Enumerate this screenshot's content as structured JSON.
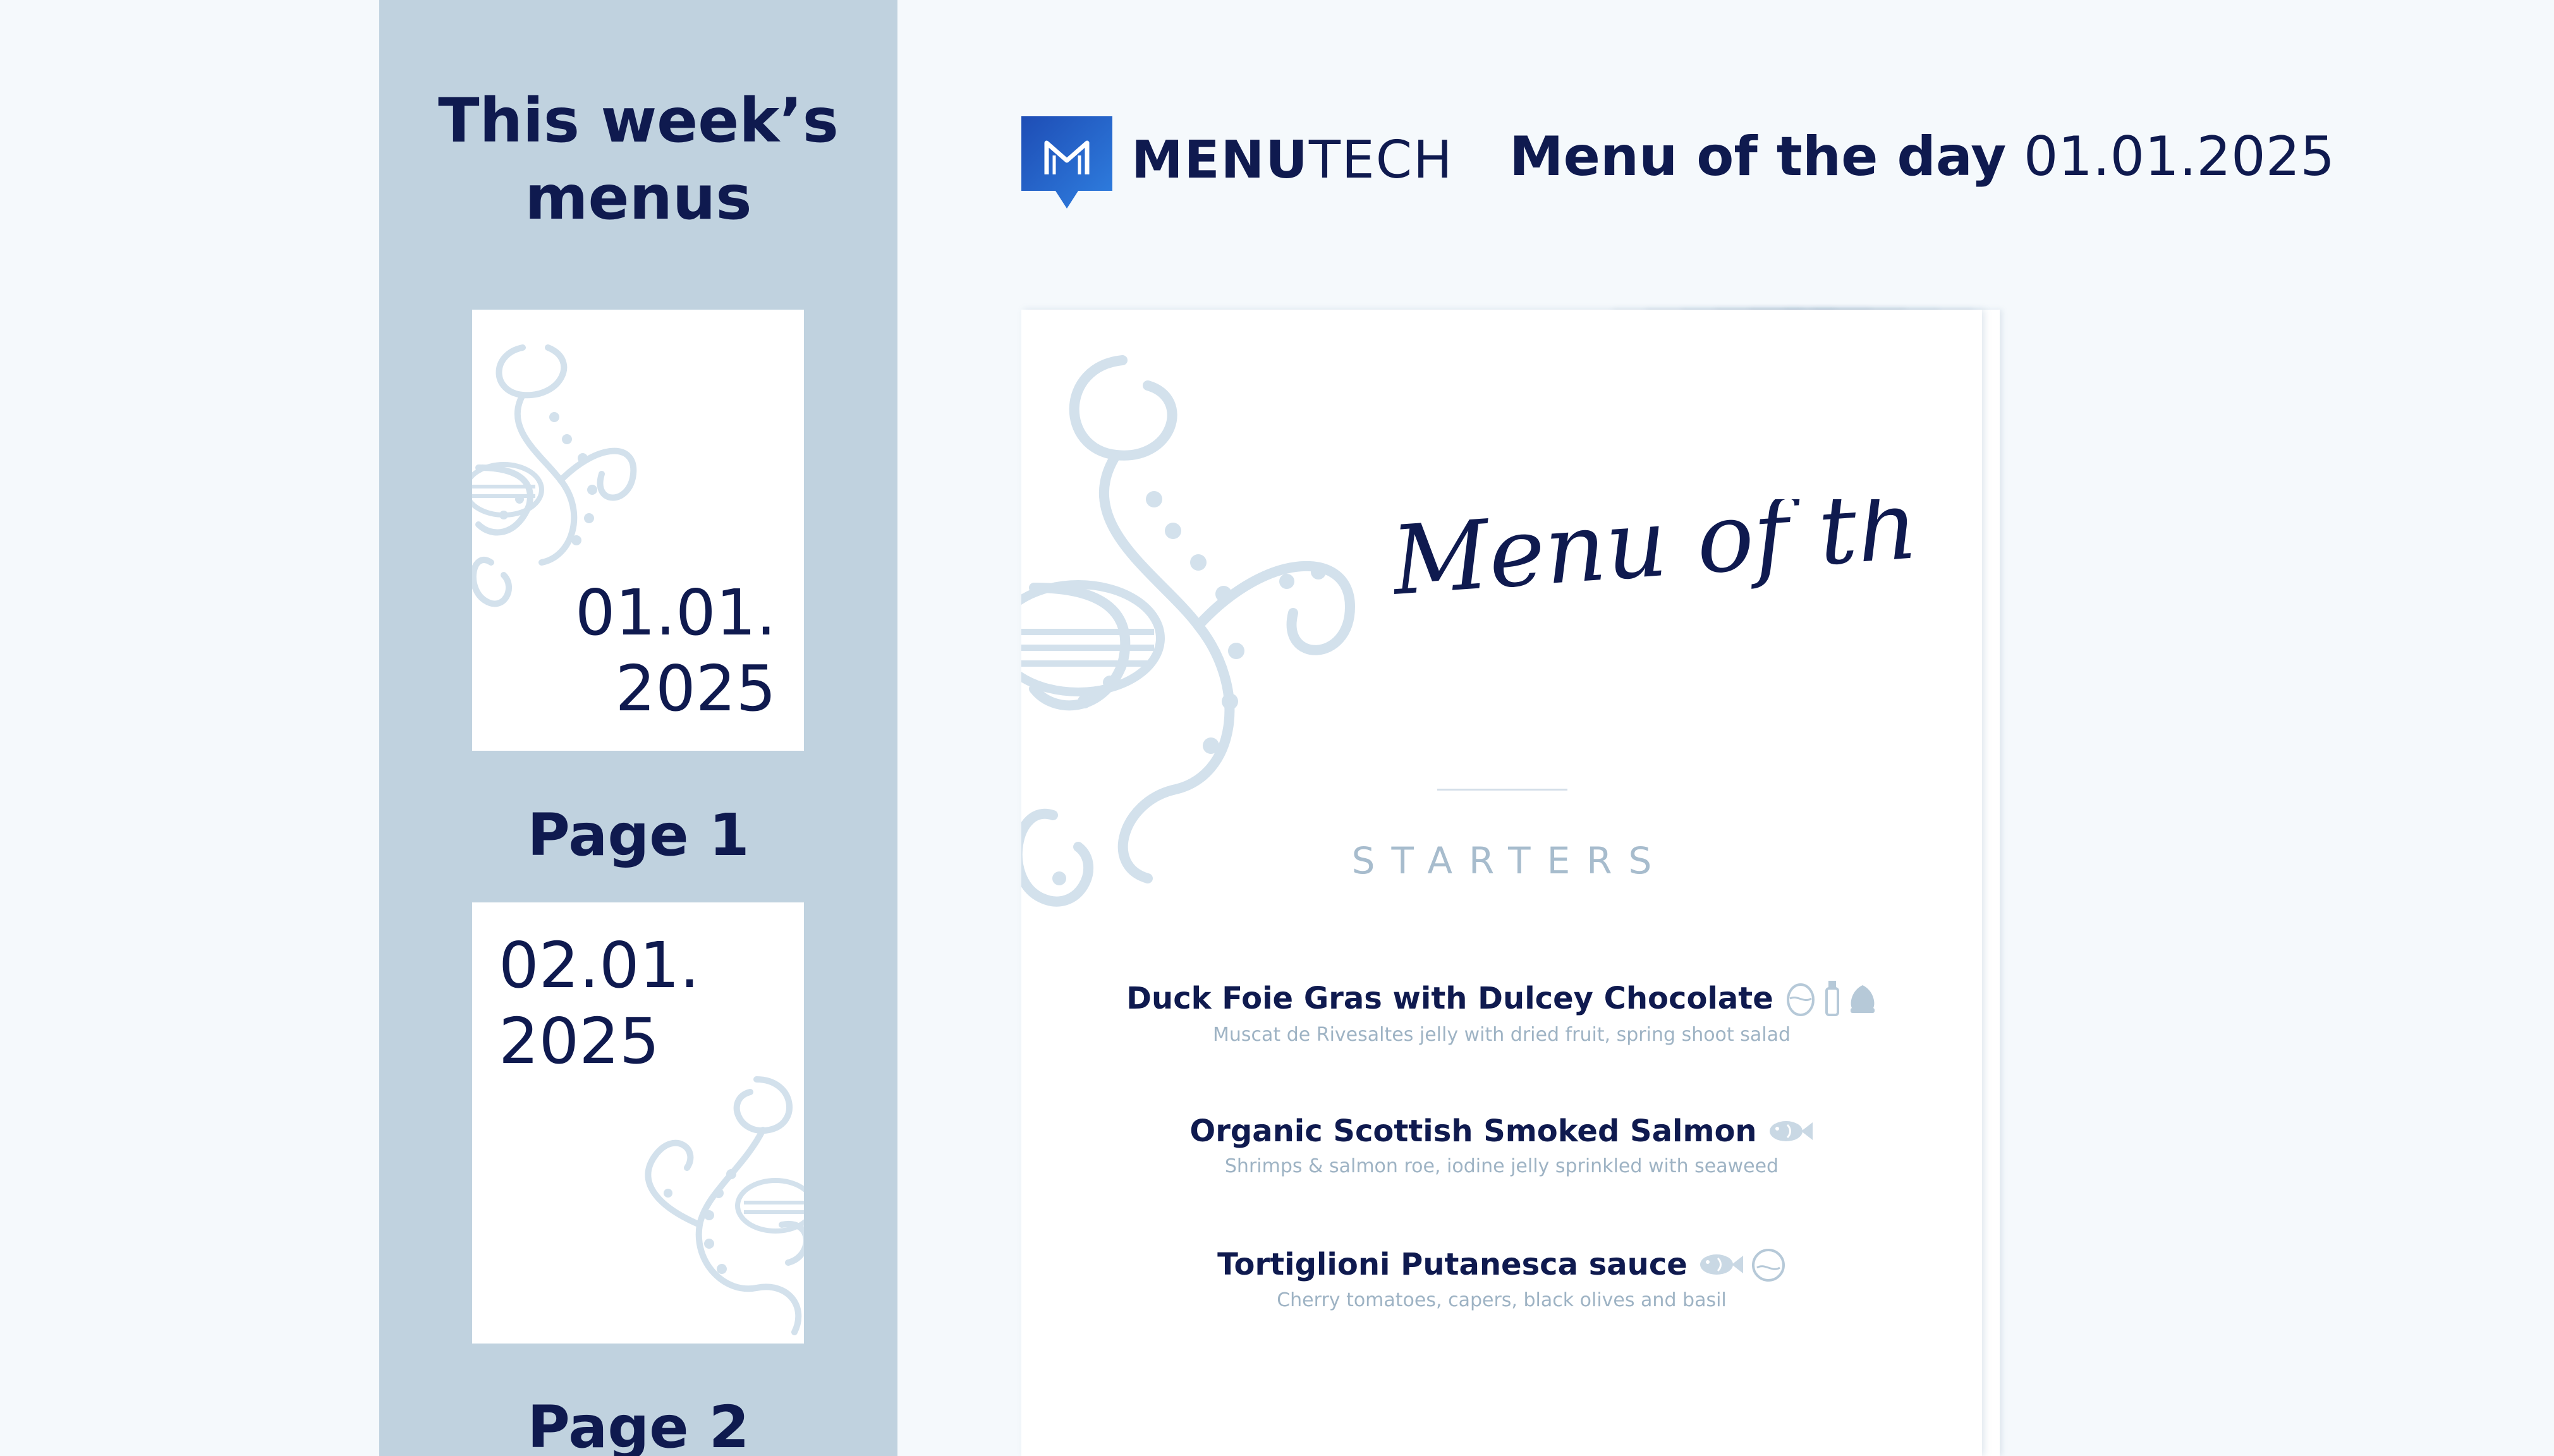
{
  "sidebar": {
    "title": "This week’s\nmenus",
    "pages": [
      {
        "date": "01.01.\n2025",
        "label": "Page 1"
      },
      {
        "date": "02.01.\n2025",
        "label": "Page 2"
      }
    ]
  },
  "header": {
    "brand_bold": "MENU",
    "brand_light": "TECH",
    "title_label": "Menu of the day",
    "title_date": "01.01.2025"
  },
  "menu": {
    "script_title": "Menu of the day",
    "section": "STARTERS",
    "dishes": [
      {
        "name": "Duck Foie Gras with Dulcey Chocolate",
        "description": "Muscat de Rivesaltes jelly with dried fruit, spring shoot salad",
        "icons": [
          "egg-icon",
          "milk-bottle-icon",
          "nut-icon"
        ]
      },
      {
        "name": "Organic Scottish Smoked Salmon",
        "description": "Shrimps & salmon roe, iodine jelly sprinkled with seaweed",
        "icons": [
          "fish-icon"
        ]
      },
      {
        "name": "Tortiglioni Putanesca sauce",
        "description": "Cherry tomatoes, capers, black olives and basil",
        "icons": [
          "fish-icon",
          "egg-icon"
        ]
      }
    ]
  },
  "colors": {
    "background": "#f5f9fc",
    "sidebar": "#c0d2df",
    "navy": "#0f1a4f",
    "brand_blue": "#1f5fc8",
    "muted": "#9eb3c4",
    "deco": "#d3e1ec"
  }
}
